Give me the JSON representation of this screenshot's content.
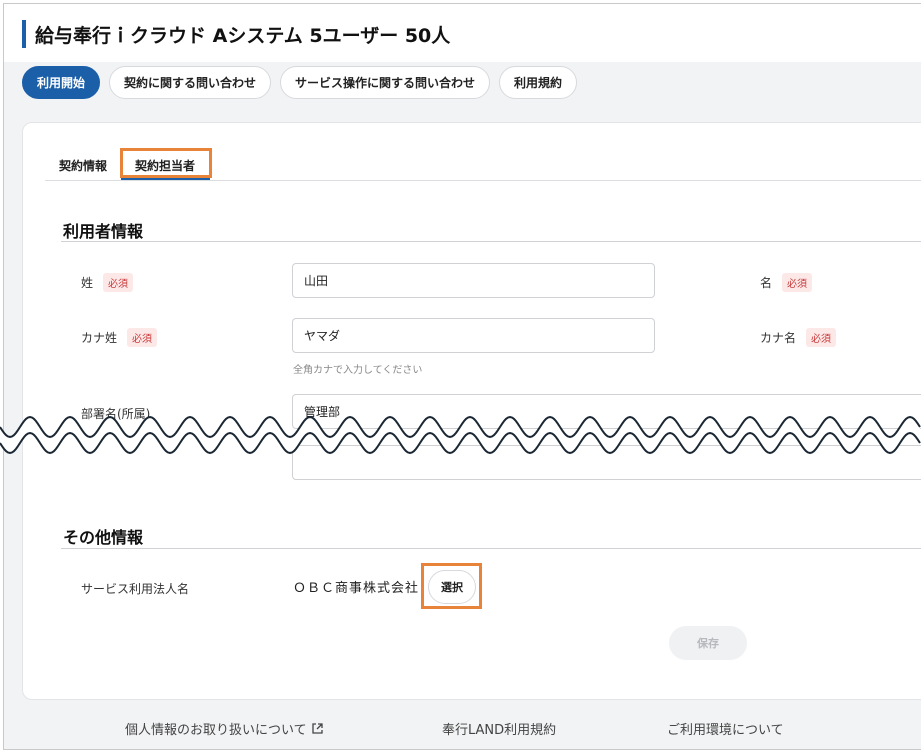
{
  "header": {
    "title": "給与奉行ｉクラウド Aシステム 5ユーザー 50人"
  },
  "tabs": [
    {
      "label": "利用開始"
    },
    {
      "label": "契約に関する問い合わせ"
    },
    {
      "label": "サービス操作に関する問い合わせ"
    },
    {
      "label": "利用規約"
    }
  ],
  "subtabs": [
    {
      "label": "契約情報"
    },
    {
      "label": "契約担当者"
    }
  ],
  "user_info": {
    "title": "利用者情報",
    "required_badge": "必須",
    "last_name_label": "姓",
    "last_name_value": "山田",
    "first_name_label": "名",
    "kana_last_label": "カナ姓",
    "kana_last_value": "ヤマダ",
    "kana_first_label": "カナ名",
    "kana_hint": "全角カナで入力してください",
    "dept_label": "部署名(所属)",
    "dept_value": "管理部"
  },
  "other_info": {
    "title": "その他情報",
    "service_corp_label": "サービス利用法人名",
    "service_corp_value": "ＯＢＣ商事株式会社",
    "select_label": "選択"
  },
  "save_label": "保存",
  "footer": {
    "privacy": "個人情報のお取り扱いについて",
    "terms": "奉行LAND利用規約",
    "environment": "ご利用環境について"
  },
  "colors": {
    "accent": "#1a5fa8",
    "highlight": "#e8833a",
    "required": "#c83b3b"
  },
  "icons": {
    "external_link": "external-link-icon"
  }
}
